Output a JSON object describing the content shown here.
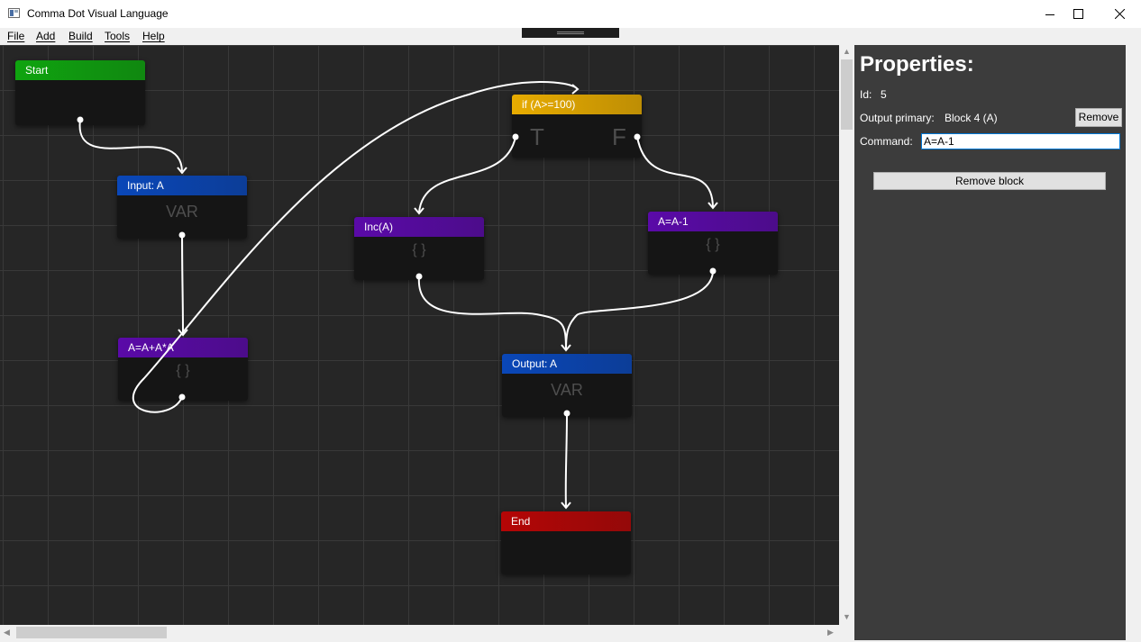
{
  "window": {
    "title": "Comma Dot Visual Language",
    "controls": [
      "minimize-icon",
      "maximize-icon",
      "close-icon"
    ]
  },
  "menu": {
    "items": [
      {
        "label": "File"
      },
      {
        "label": "Add"
      },
      {
        "label": "Build"
      },
      {
        "label": "Tools"
      },
      {
        "label": "Help"
      }
    ]
  },
  "canvas": {
    "blocks": [
      {
        "id": "start",
        "title": "Start",
        "color": "#0fa40f",
        "body": ""
      },
      {
        "id": "input",
        "title": "Input: A",
        "color": "#0a47b8",
        "body": "VAR"
      },
      {
        "id": "assign1",
        "title": "A=A+A*A",
        "color": "#5a0aa8",
        "body": "{ }"
      },
      {
        "id": "if",
        "title": "if (A>=100)",
        "color": "#e8ac00",
        "true_label": "T",
        "false_label": "F"
      },
      {
        "id": "inc",
        "title": "Inc(A)",
        "color": "#5a0aa8",
        "body": "{ }"
      },
      {
        "id": "assign2",
        "title": "A=A-1",
        "color": "#5a0aa8",
        "body": "{ }"
      },
      {
        "id": "output",
        "title": "Output: A",
        "color": "#0a47b8",
        "body": "VAR"
      },
      {
        "id": "end",
        "title": "End",
        "color": "#b40606",
        "body": ""
      }
    ]
  },
  "properties": {
    "title": "Properties:",
    "id_label": "Id:",
    "id_value": "5",
    "output_label": "Output primary:",
    "output_value": "Block 4 (A)",
    "remove_output_label": "Remove",
    "command_label": "Command:",
    "command_value": "A=A-1",
    "remove_block_label": "Remove block"
  }
}
